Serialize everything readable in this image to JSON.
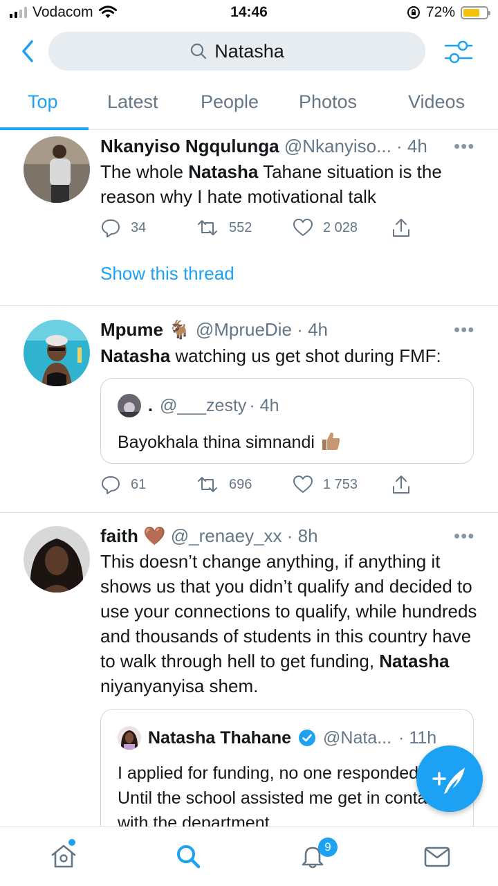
{
  "status_bar": {
    "carrier": "Vodacom",
    "time": "14:46",
    "battery": "72%",
    "battery_level": 0.72,
    "icons": [
      "signal-bars-icon",
      "wifi-icon",
      "orientation-lock-icon",
      "battery-icon"
    ]
  },
  "search": {
    "query": "Natasha",
    "back_icon": "chevron-left-icon",
    "search_icon": "search-icon",
    "filter_icon": "sliders-icon"
  },
  "tabs": [
    {
      "label": "Top",
      "active": true
    },
    {
      "label": "Latest",
      "active": false
    },
    {
      "label": "People",
      "active": false
    },
    {
      "label": "Photos",
      "active": false
    },
    {
      "label": "Videos",
      "active": false
    }
  ],
  "tweets": [
    {
      "name": "Nkanyiso Ngqulunga",
      "handle": "@Nkanyiso...",
      "time": "· 4h",
      "body_pre": "The whole ",
      "body_bold": "Natasha",
      "body_post": " Tahane situation is the reason why I hate motivational talk",
      "replies": "34",
      "retweets": "552",
      "likes": "2 028",
      "show_thread": "Show this thread"
    },
    {
      "name": "Mpume",
      "name_emoji": "🐐",
      "handle": "@MprueDie",
      "time": "· 4h",
      "body_bold": "Natasha",
      "body_post": " watching us get shot during FMF:",
      "quote": {
        "name": ".",
        "handle": "@___zesty",
        "time": "· 4h",
        "text": "Bayokhala thina simnandi"
      },
      "replies": "61",
      "retweets": "696",
      "likes": "1 753"
    },
    {
      "name": "faith",
      "name_emoji": "🤎",
      "handle": "@_renaey_xx",
      "time": "· 8h",
      "body_pre": "This doesn’t change anything, if anything it shows us that you didn’t qualify and decided to use your connections to qualify, while hundreds and thousands of students in this country have to walk through hell to get funding, ",
      "body_bold": "Natasha",
      "body_post": " niyanyanyisa shem.",
      "quote": {
        "name": "Natasha Thahane",
        "handle": "@Nata...",
        "time": "· 11h",
        "text": "I applied for funding, no one responded. Until the school assisted me get in contact with the department."
      }
    }
  ],
  "more_label": "•••",
  "bottom_nav": {
    "items": [
      "home-icon",
      "search-icon",
      "notifications-icon",
      "messages-icon"
    ],
    "notification_count": "9"
  },
  "fab": {
    "icon": "compose-tweet-icon"
  }
}
